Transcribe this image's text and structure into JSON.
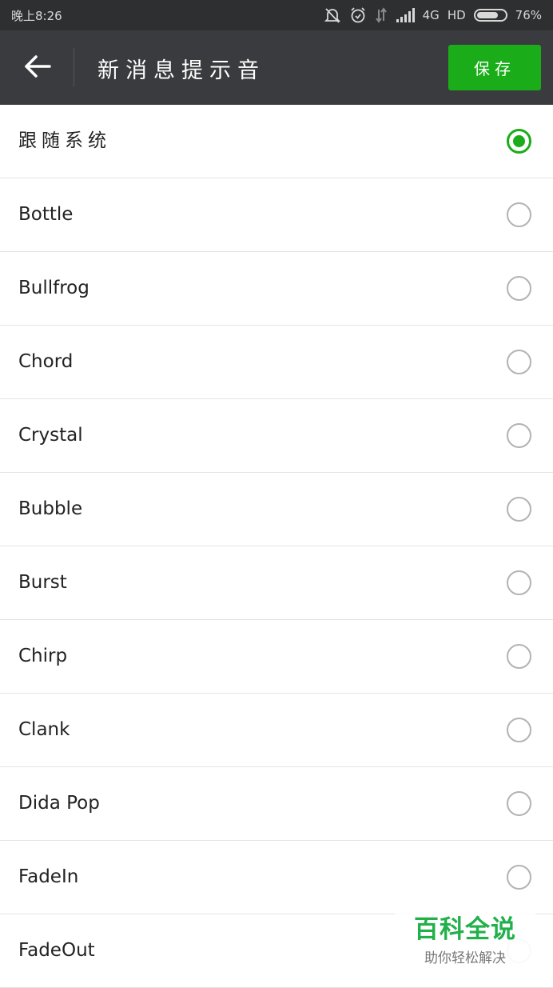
{
  "status_bar": {
    "time": "晚上8:26",
    "network": "4G",
    "hd": "HD",
    "battery_percent": "76%",
    "battery_level": 0.76,
    "icons": [
      "bell-muted-icon",
      "alarm-icon",
      "data-arrows-icon",
      "signal-icon",
      "battery-icon"
    ]
  },
  "header": {
    "title": "新消息提示音",
    "save_label": "保存",
    "back_icon": "arrow-left-icon"
  },
  "colors": {
    "accent": "#1aad19",
    "header_bg": "#3a3b3e",
    "status_bg": "#2e2f31"
  },
  "sounds": [
    {
      "label": "跟随系统",
      "selected": true
    },
    {
      "label": "Bottle",
      "selected": false
    },
    {
      "label": "Bullfrog",
      "selected": false
    },
    {
      "label": "Chord",
      "selected": false
    },
    {
      "label": "Crystal",
      "selected": false
    },
    {
      "label": "Bubble",
      "selected": false
    },
    {
      "label": "Burst",
      "selected": false
    },
    {
      "label": "Chirp",
      "selected": false
    },
    {
      "label": "Clank",
      "selected": false
    },
    {
      "label": "Dida Pop",
      "selected": false
    },
    {
      "label": "FadeIn",
      "selected": false
    },
    {
      "label": "FadeOut",
      "selected": false
    }
  ],
  "watermark": {
    "main": "百科全说",
    "sub": "助你轻松解决"
  }
}
